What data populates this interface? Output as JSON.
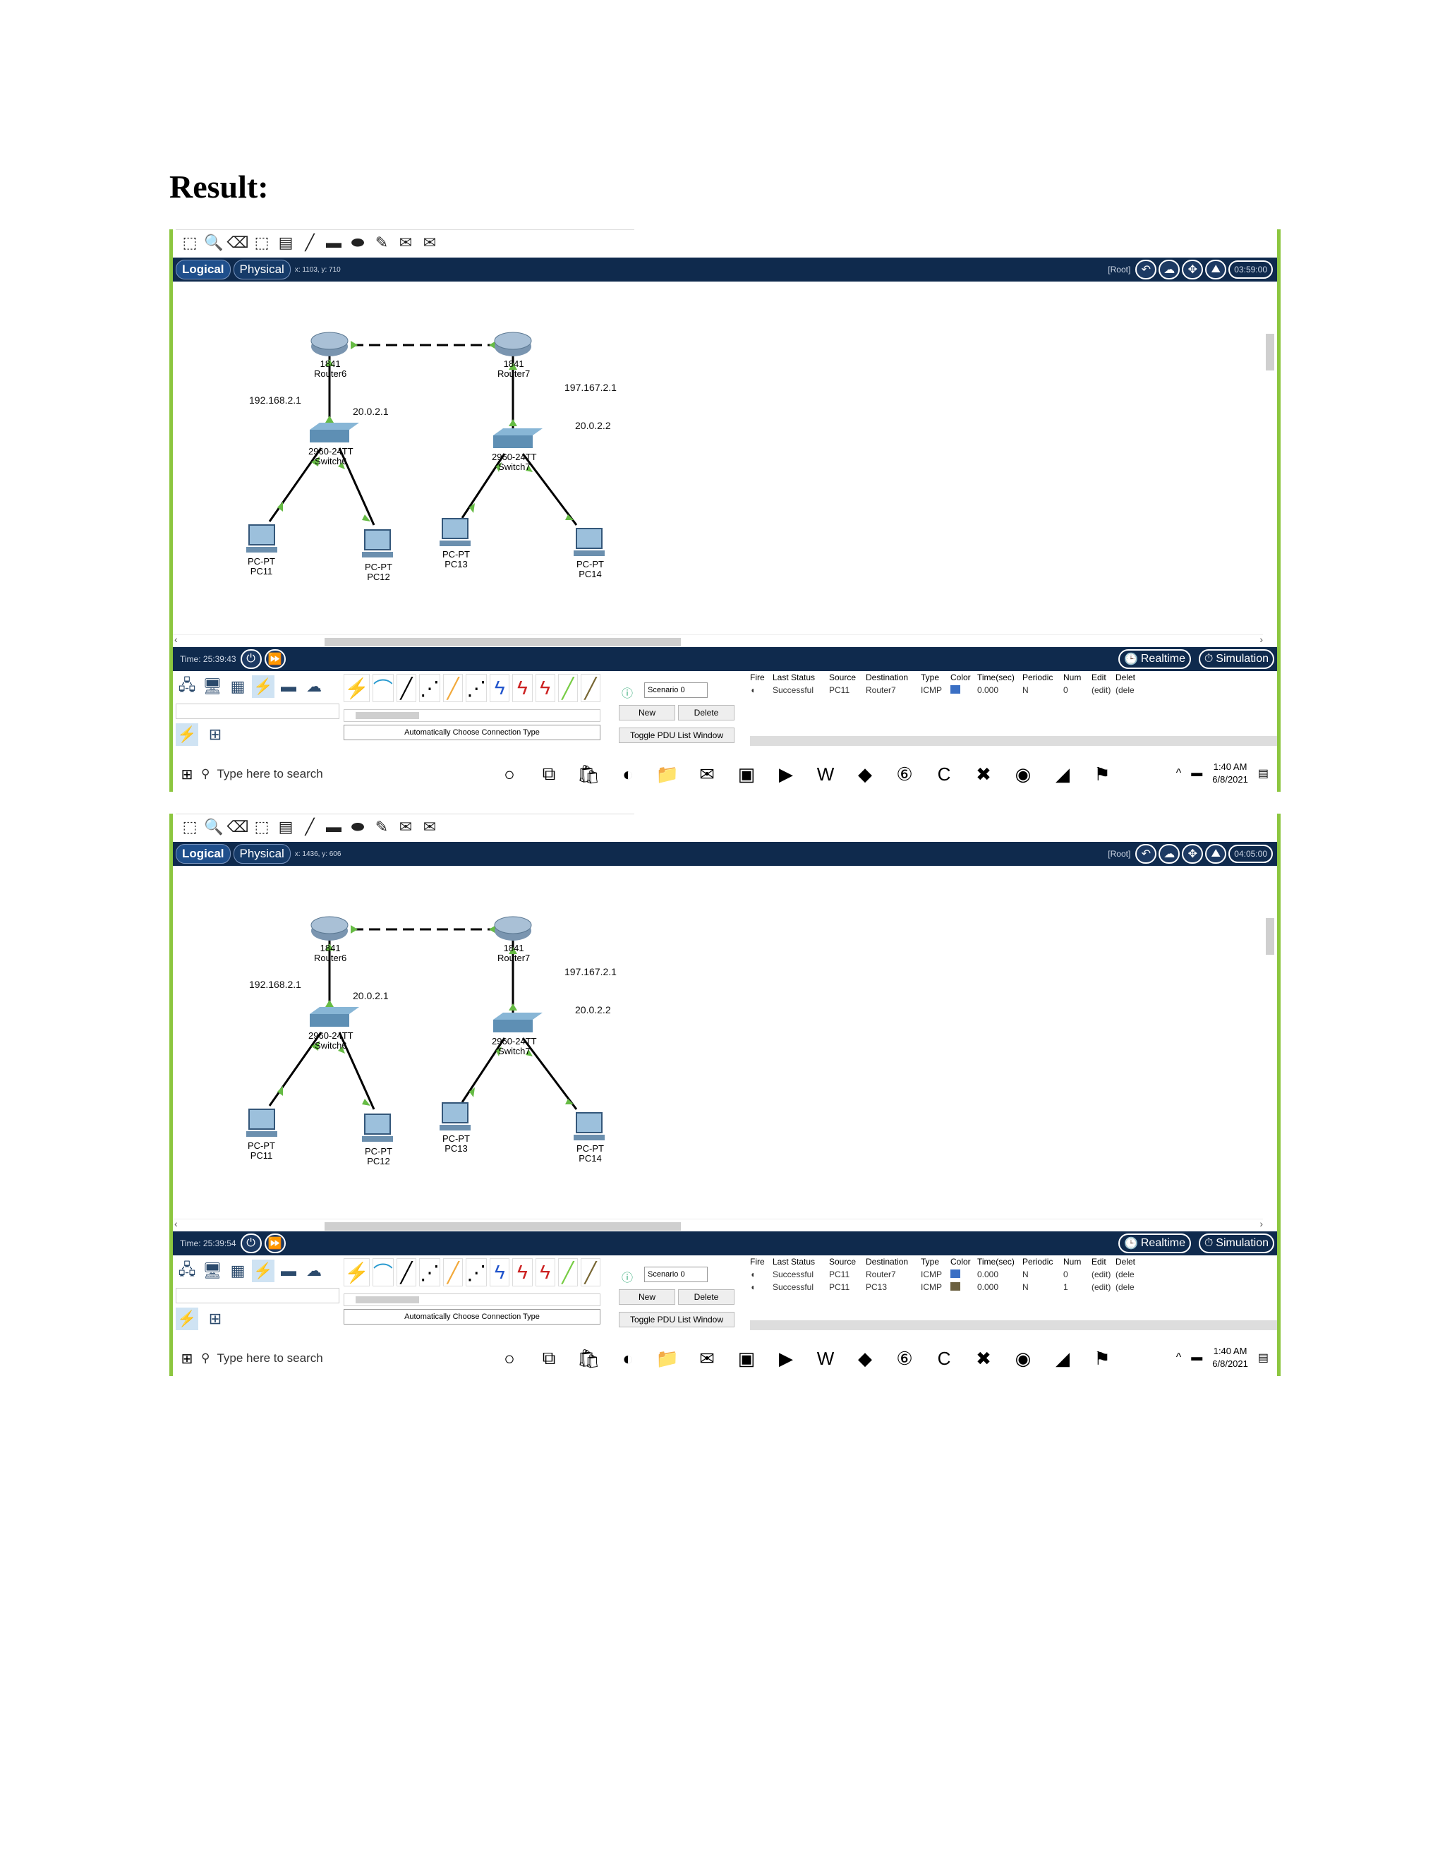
{
  "document": {
    "title": "Result:"
  },
  "screenshots": [
    {
      "tabs": {
        "logical": "Logical",
        "physical": "Physical"
      },
      "coords": "x: 1103, y: 710",
      "root": "[Root]",
      "clock": "03:59:00",
      "time": "Time: 25:39:43",
      "modes": {
        "realtime": "Realtime",
        "simulation": "Simulation"
      },
      "connection_label": "Automatically Choose Connection Type",
      "scenario": "Scenario 0",
      "buttons": {
        "new": "New",
        "delete": "Delete",
        "toggle": "Toggle PDU List Window"
      },
      "pdu_headers": [
        "Fire",
        "Last Status",
        "Source",
        "Destination",
        "Type",
        "Color",
        "Time(sec)",
        "Periodic",
        "Num",
        "Edit",
        "Delet"
      ],
      "pdus": [
        {
          "status": "Successful",
          "source": "PC11",
          "destination": "Router7",
          "type": "ICMP",
          "color": "#3a6fc4",
          "time": "0.000",
          "periodic": "N",
          "num": "0",
          "edit": "(edit)",
          "delete": "(dele"
        }
      ],
      "search_placeholder": "Type here to search",
      "taskbar_time": "1:40 AM",
      "taskbar_date": "6/8/2021"
    },
    {
      "tabs": {
        "logical": "Logical",
        "physical": "Physical"
      },
      "coords": "x: 1436, y: 606",
      "root": "[Root]",
      "clock": "04:05:00",
      "time": "Time: 25:39:54",
      "modes": {
        "realtime": "Realtime",
        "simulation": "Simulation"
      },
      "connection_label": "Automatically Choose Connection Type",
      "scenario": "Scenario 0",
      "buttons": {
        "new": "New",
        "delete": "Delete",
        "toggle": "Toggle PDU List Window"
      },
      "pdu_headers": [
        "Fire",
        "Last Status",
        "Source",
        "Destination",
        "Type",
        "Color",
        "Time(sec)",
        "Periodic",
        "Num",
        "Edit",
        "Delet"
      ],
      "pdus": [
        {
          "status": "Successful",
          "source": "PC11",
          "destination": "Router7",
          "type": "ICMP",
          "color": "#3a6fc4",
          "time": "0.000",
          "periodic": "N",
          "num": "0",
          "edit": "(edit)",
          "delete": "(dele"
        },
        {
          "status": "Successful",
          "source": "PC11",
          "destination": "PC13",
          "type": "ICMP",
          "color": "#6b6040",
          "time": "0.000",
          "periodic": "N",
          "num": "1",
          "edit": "(edit)",
          "delete": "(dele"
        }
      ],
      "search_placeholder": "Type here to search",
      "taskbar_time": "1:40 AM",
      "taskbar_date": "6/8/2021"
    }
  ],
  "topology": {
    "routers": [
      {
        "model": "1841",
        "name": "Router6"
      },
      {
        "model": "1841",
        "name": "Router7"
      }
    ],
    "switches": [
      {
        "model": "2960-24TT",
        "name": "Switch6"
      },
      {
        "model": "2960-24TT",
        "name": "Switch7"
      }
    ],
    "pcs": [
      {
        "model": "PC-PT",
        "name": "PC11"
      },
      {
        "model": "PC-PT",
        "name": "PC12"
      },
      {
        "model": "PC-PT",
        "name": "PC13"
      },
      {
        "model": "PC-PT",
        "name": "PC14"
      }
    ],
    "ip_labels": [
      "192.168.2.1",
      "20.0.2.1",
      "197.167.2.1",
      "20.0.2.2"
    ]
  },
  "colors": {
    "frame": "#8cc63f",
    "navbar": "#0f2a4d",
    "link_dot": "#66bb44"
  }
}
